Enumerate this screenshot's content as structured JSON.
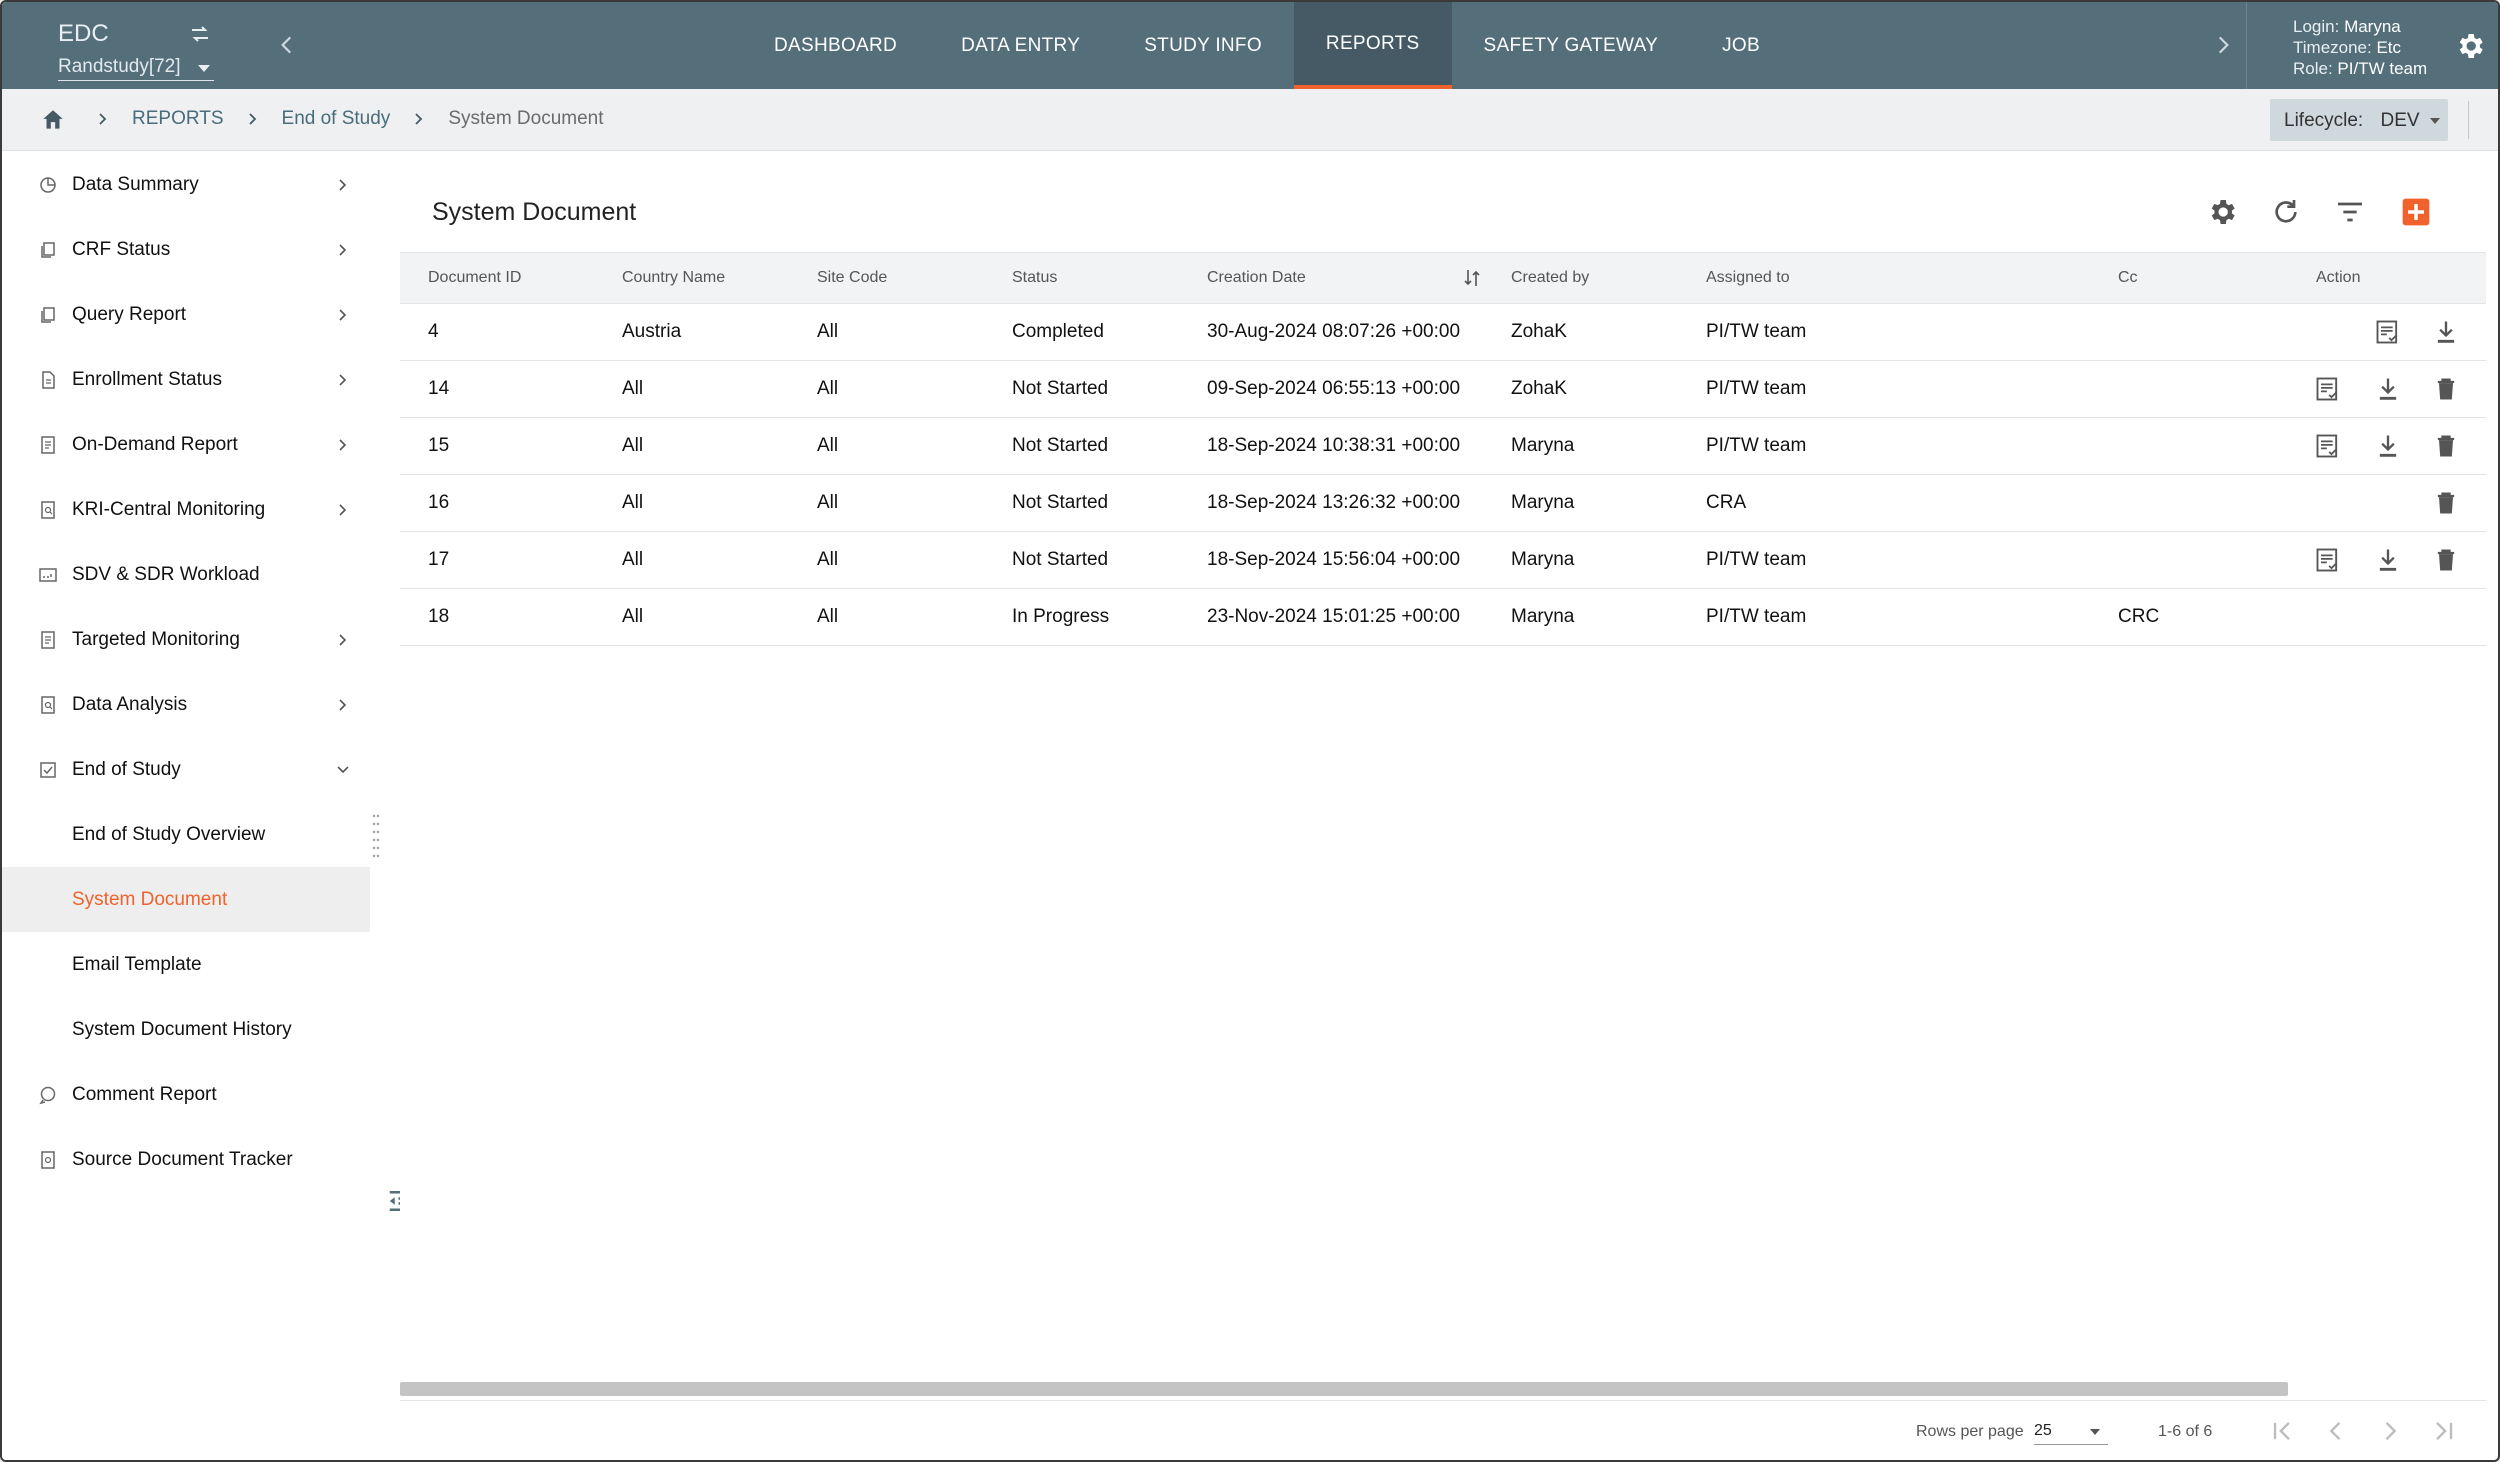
{
  "header": {
    "app_title": "EDC",
    "study": "Randstudy[72]",
    "tabs": [
      {
        "label": "DASHBOARD",
        "active": false
      },
      {
        "label": "DATA ENTRY",
        "active": false
      },
      {
        "label": "STUDY INFO",
        "active": false
      },
      {
        "label": "REPORTS",
        "active": true
      },
      {
        "label": "SAFETY GATEWAY",
        "active": false
      },
      {
        "label": "JOB",
        "active": false
      }
    ],
    "user": {
      "login_label": "Login:",
      "login": "Maryna",
      "timezone_label": "Timezone:",
      "timezone": "Etc",
      "role_label": "Role:",
      "role": "PI/TW team"
    }
  },
  "breadcrumb": {
    "items": [
      "REPORTS",
      "End of Study"
    ],
    "current": "System Document",
    "lifecycle_label": "Lifecycle:",
    "lifecycle_value": "DEV"
  },
  "sidebar": {
    "items": [
      {
        "label": "Data Summary",
        "icon": "pie-chart-icon",
        "chevron": "right"
      },
      {
        "label": "CRF Status",
        "icon": "copy-icon",
        "chevron": "right"
      },
      {
        "label": "Query Report",
        "icon": "copy-icon",
        "chevron": "right"
      },
      {
        "label": "Enrollment Status",
        "icon": "document-icon",
        "chevron": "right"
      },
      {
        "label": "On-Demand Report",
        "icon": "report-icon",
        "chevron": "right"
      },
      {
        "label": "KRI-Central Monitoring",
        "icon": "report-search-icon",
        "chevron": "right"
      },
      {
        "label": "SDV & SDR Workload",
        "icon": "workload-icon",
        "chevron": ""
      },
      {
        "label": "Targeted Monitoring",
        "icon": "report-icon",
        "chevron": "right"
      },
      {
        "label": "Data Analysis",
        "icon": "report-search-icon",
        "chevron": "right"
      },
      {
        "label": "End of Study",
        "icon": "check-square-icon",
        "chevron": "down"
      },
      {
        "label": "End of Study Overview",
        "icon": "",
        "chevron": ""
      },
      {
        "label": "System Document",
        "icon": "",
        "chevron": "",
        "active": true
      },
      {
        "label": "Email Template",
        "icon": "",
        "chevron": ""
      },
      {
        "label": "System Document History",
        "icon": "",
        "chevron": ""
      },
      {
        "label": "Comment Report",
        "icon": "comment-icon",
        "chevron": ""
      },
      {
        "label": "Source Document Tracker",
        "icon": "tracker-icon",
        "chevron": ""
      }
    ]
  },
  "main": {
    "title": "System Document",
    "columns": [
      "Document ID",
      "Country Name",
      "Site Code",
      "Status",
      "Creation Date",
      "Created by",
      "Assigned to",
      "Cc",
      "Action"
    ],
    "rows": [
      {
        "id": "4",
        "country": "Austria",
        "site": "All",
        "status": "Completed",
        "created": "30-Aug-2024 08:07:26 +00:00",
        "by": "ZohaK",
        "assigned": "PI/TW team",
        "cc": "",
        "actions": [
          "review",
          "download"
        ]
      },
      {
        "id": "14",
        "country": "All",
        "site": "All",
        "status": "Not Started",
        "created": "09-Sep-2024 06:55:13 +00:00",
        "by": "ZohaK",
        "assigned": "PI/TW team",
        "cc": "",
        "actions": [
          "review",
          "download",
          "delete"
        ]
      },
      {
        "id": "15",
        "country": "All",
        "site": "All",
        "status": "Not Started",
        "created": "18-Sep-2024 10:38:31 +00:00",
        "by": "Maryna",
        "assigned": "PI/TW team",
        "cc": "",
        "actions": [
          "review",
          "download",
          "delete"
        ]
      },
      {
        "id": "16",
        "country": "All",
        "site": "All",
        "status": "Not Started",
        "created": "18-Sep-2024 13:26:32 +00:00",
        "by": "Maryna",
        "assigned": "CRA",
        "cc": "",
        "actions": [
          "delete"
        ]
      },
      {
        "id": "17",
        "country": "All",
        "site": "All",
        "status": "Not Started",
        "created": "18-Sep-2024 15:56:04 +00:00",
        "by": "Maryna",
        "assigned": "PI/TW team",
        "cc": "",
        "actions": [
          "review",
          "download",
          "delete"
        ]
      },
      {
        "id": "18",
        "country": "All",
        "site": "All",
        "status": "In Progress",
        "created": "23-Nov-2024 15:01:25 +00:00",
        "by": "Maryna",
        "assigned": "PI/TW team",
        "cc": "CRC",
        "actions": []
      }
    ],
    "pagination": {
      "rows_per_page_label": "Rows per page",
      "rows_per_page": "25",
      "range": "1-6 of 6"
    }
  },
  "colors": {
    "topbar": "#546e7a",
    "accent": "#f0622c",
    "active_tab": "#455a64"
  }
}
